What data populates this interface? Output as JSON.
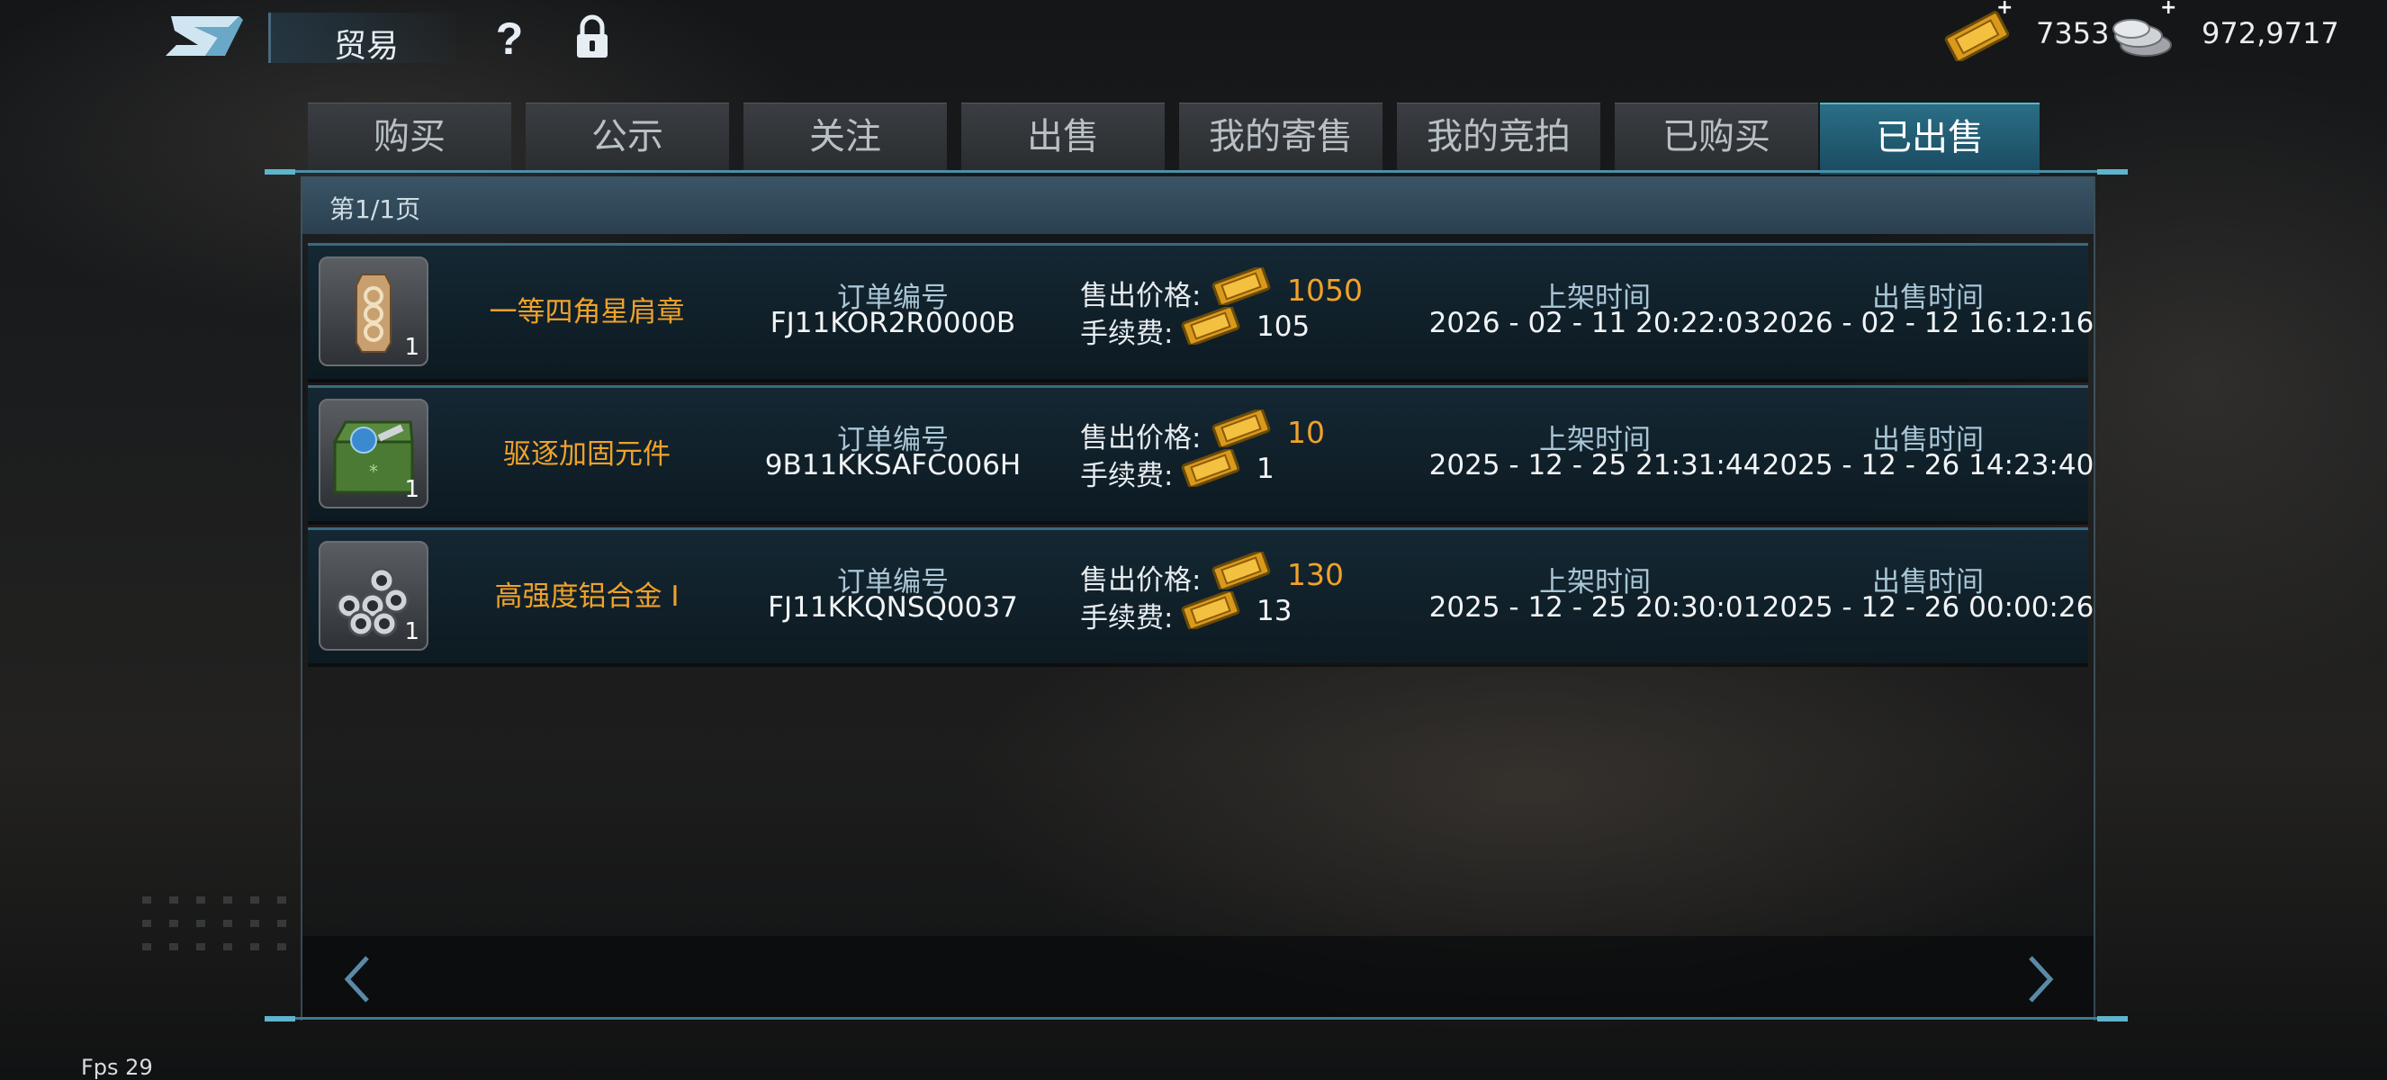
{
  "header": {
    "title": "贸易",
    "logo_icon": "game-logo-icon",
    "help_icon": "question-icon",
    "lock_icon": "lock-icon"
  },
  "currency": {
    "tickets": "7353",
    "coins": "972,9717",
    "ticket_icon": "gold-ticket-icon",
    "coin_icon": "silver-coins-icon",
    "plus": "+"
  },
  "tabs": [
    {
      "label": "购买",
      "active": false
    },
    {
      "label": "公示",
      "active": false
    },
    {
      "label": "关注",
      "active": false
    },
    {
      "label": "出售",
      "active": false
    },
    {
      "label": "我的寄售",
      "active": false
    },
    {
      "label": "我的竞拍",
      "active": false
    },
    {
      "label": "已购买",
      "active": false
    },
    {
      "label": "已出售",
      "active": true
    }
  ],
  "page_indicator": "第1/1页",
  "labels": {
    "order_no": "订单编号",
    "sale_price": "售出价格:",
    "fee": "手续费:",
    "listed_time": "上架时间",
    "sold_time": "出售时间"
  },
  "orders": [
    {
      "name": "一等四角星肩章",
      "qty": "1",
      "icon": "epaulette-icon",
      "order_no": "FJ11KOR2R0000B",
      "price": "1050",
      "fee": "105",
      "listed": "2026 - 02 - 11 20:22:03",
      "sold": "2026 - 02 - 12 16:12:16"
    },
    {
      "name": "驱逐加固元件",
      "qty": "1",
      "icon": "supply-crate-icon",
      "order_no": "9B11KKSAFC006H",
      "price": "10",
      "fee": "1",
      "listed": "2025 - 12 - 25 21:31:44",
      "sold": "2025 - 12 - 26 14:23:40"
    },
    {
      "name": "高强度铝合金 I",
      "qty": "1",
      "icon": "aluminum-pipes-icon",
      "order_no": "FJ11KKQNSQ0037",
      "price": "130",
      "fee": "13",
      "listed": "2025 - 12 - 25 20:30:01",
      "sold": "2025 - 12 - 26 00:00:26"
    }
  ],
  "nav": {
    "prev_icon": "chevron-left-icon",
    "next_icon": "chevron-right-icon"
  },
  "fps": "Fps 29"
}
